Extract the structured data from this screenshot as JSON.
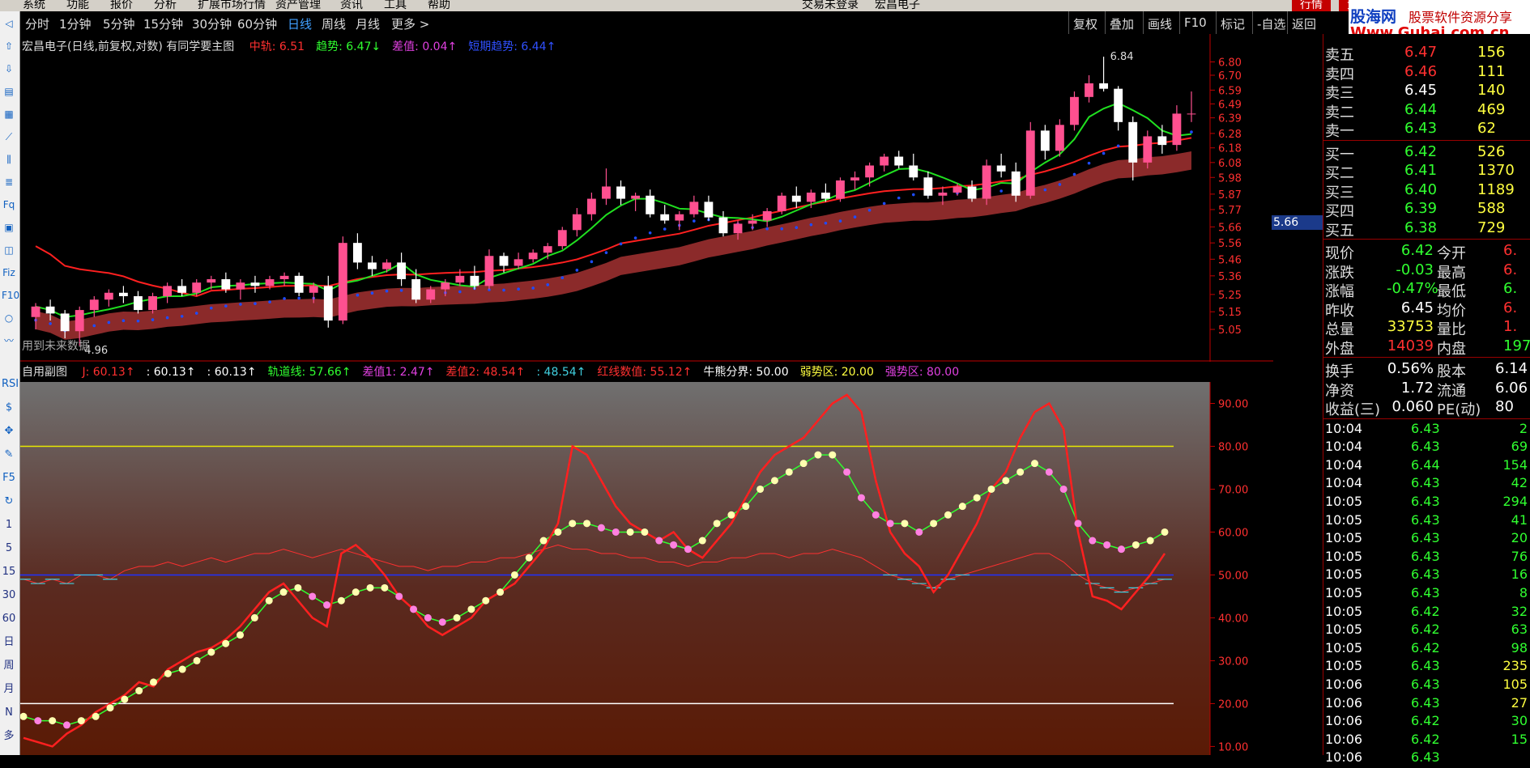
{
  "menubar": {
    "items": [
      "系统",
      "功能",
      "报价",
      "分析",
      "扩展市场行情",
      "资产管理",
      "资讯",
      "工具",
      "帮助"
    ],
    "center_left": "交易未登录",
    "center_right": "宏昌电子",
    "right_buttons": [
      "行情",
      "资"
    ]
  },
  "banner": {
    "site": "股海网",
    "slogan": "股票软件资源分享",
    "url": "Www.Guhai.com.cn"
  },
  "left_toolbar": {
    "icons": [
      "back-arrow-icon",
      "up-arrow-icon",
      "down-arrow-icon",
      "report-icon",
      "grid-icon",
      "line-chart-icon",
      "candle-icon",
      "list-icon",
      "fq-icon",
      "news-icon",
      "calendar-icon",
      "fiz-icon",
      "f10-icon",
      "circle-icon",
      "wave-icon"
    ],
    "labels": [
      "RSI",
      "$",
      "✥",
      "✎",
      "F5",
      "↻",
      "1",
      "5",
      "15",
      "30",
      "60",
      "日",
      "周",
      "月",
      "N",
      "多"
    ]
  },
  "period_bar": {
    "periods": [
      "分时",
      "1分钟",
      "5分钟",
      "15分钟",
      "30分钟",
      "60分钟",
      "日线",
      "周线",
      "月线",
      "更多 >"
    ],
    "active": "日线",
    "right_buttons": [
      "复权",
      "叠加",
      "画线",
      "F10",
      "标记",
      "-自选",
      "返回"
    ]
  },
  "main_chart": {
    "title": "宏昌电子(日线,前复权,对数) 有同学要主图",
    "legend": [
      {
        "label": "中轨: 6.51",
        "color": "#ff3030"
      },
      {
        "label": "趋势: 6.47↓",
        "color": "#30ff30"
      },
      {
        "label": "差值: 0.04↑",
        "color": "#e040e0"
      },
      {
        "label": "短期趋势: 6.44↑",
        "color": "#3050ff"
      }
    ],
    "price_axis": [
      "6.80",
      "6.70",
      "6.59",
      "6.49",
      "6.39",
      "6.28",
      "6.18",
      "6.08",
      "5.98",
      "5.87",
      "5.77",
      "5.66",
      "5.56",
      "5.46",
      "5.36",
      "5.25",
      "5.15",
      "5.05"
    ],
    "current_price_label": "5.66",
    "high_label": "6.84",
    "low_label": "4.96",
    "no_data_text": "用到未来数据"
  },
  "sub_chart": {
    "title": "自用副图",
    "legend": [
      {
        "label": "J: 60.13↑",
        "color": "#ff3030"
      },
      {
        "label": ": 60.13↑",
        "color": "#ffffff"
      },
      {
        "label": ": 60.13↑",
        "color": "#ffffff"
      },
      {
        "label": "轨道线: 57.66↑",
        "color": "#30ff30"
      },
      {
        "label": "差值1: 2.47↑",
        "color": "#e040e0"
      },
      {
        "label": "差值2: 48.54↑",
        "color": "#ff3030"
      },
      {
        "label": ": 48.54↑",
        "color": "#40d0e0"
      },
      {
        "label": "红线数值: 55.12↑",
        "color": "#ff3030"
      },
      {
        "label": "牛熊分界: 50.00",
        "color": "#ffffff"
      },
      {
        "label": "弱势区: 20.00",
        "color": "#ffff40"
      },
      {
        "label": "强势区: 80.00",
        "color": "#e040e0"
      }
    ],
    "axis": [
      "90.00",
      "80.00",
      "70.00",
      "60.00",
      "50.00",
      "40.00",
      "30.00",
      "20.00",
      "10.00"
    ]
  },
  "quote": {
    "sell": [
      {
        "label": "卖五",
        "price": "6.47",
        "vol": "156"
      },
      {
        "label": "卖四",
        "price": "6.46",
        "vol": "111"
      },
      {
        "label": "卖三",
        "price": "6.45",
        "vol": "140"
      },
      {
        "label": "卖二",
        "price": "6.44",
        "vol": "469"
      },
      {
        "label": "卖一",
        "price": "6.43",
        "vol": "62"
      }
    ],
    "buy": [
      {
        "label": "买一",
        "price": "6.42",
        "vol": "526"
      },
      {
        "label": "买二",
        "price": "6.41",
        "vol": "1370"
      },
      {
        "label": "买三",
        "price": "6.40",
        "vol": "1189"
      },
      {
        "label": "买四",
        "price": "6.39",
        "vol": "588"
      },
      {
        "label": "买五",
        "price": "6.38",
        "vol": "729"
      }
    ],
    "stats": [
      {
        "l1": "现价",
        "v1": "6.42",
        "c1": "#30ff30",
        "l2": "今开",
        "v2": "6.",
        "c2": "#ff3030"
      },
      {
        "l1": "涨跌",
        "v1": "-0.03",
        "c1": "#30ff30",
        "l2": "最高",
        "v2": "6.",
        "c2": "#ff3030"
      },
      {
        "l1": "涨幅",
        "v1": "-0.47%",
        "c1": "#30ff30",
        "l2": "最低",
        "v2": "6.",
        "c2": "#30ff30"
      },
      {
        "l1": "昨收",
        "v1": "6.45",
        "c1": "#ffffff",
        "l2": "均价",
        "v2": "6.",
        "c2": "#ff3030"
      },
      {
        "l1": "总量",
        "v1": "33753",
        "c1": "#ffff40",
        "l2": "量比",
        "v2": "1.",
        "c2": "#ff3030"
      },
      {
        "l1": "外盘",
        "v1": "14039",
        "c1": "#ff3030",
        "l2": "内盘",
        "v2": "197",
        "c2": "#30ff30"
      }
    ],
    "fin": [
      {
        "l1": "换手",
        "v1": "0.56%",
        "l2": "股本",
        "v2": "6.14"
      },
      {
        "l1": "净资",
        "v1": "1.72",
        "l2": "流通",
        "v2": "6.06"
      },
      {
        "l1": "收益(三)",
        "v1": "0.060",
        "l2": "PE(动)",
        "v2": "80"
      }
    ],
    "ticks": [
      {
        "t": "10:04",
        "p": "6.43",
        "v": "2",
        "c": "#30ff30"
      },
      {
        "t": "10:04",
        "p": "6.43",
        "v": "69",
        "c": "#30ff30"
      },
      {
        "t": "10:04",
        "p": "6.44",
        "v": "154",
        "c": "#30ff30"
      },
      {
        "t": "10:04",
        "p": "6.43",
        "v": "42",
        "c": "#30ff30"
      },
      {
        "t": "10:05",
        "p": "6.43",
        "v": "294",
        "c": "#30ff30"
      },
      {
        "t": "10:05",
        "p": "6.43",
        "v": "41",
        "c": "#30ff30"
      },
      {
        "t": "10:05",
        "p": "6.43",
        "v": "20",
        "c": "#30ff30"
      },
      {
        "t": "10:05",
        "p": "6.43",
        "v": "76",
        "c": "#30ff30"
      },
      {
        "t": "10:05",
        "p": "6.43",
        "v": "16",
        "c": "#30ff30"
      },
      {
        "t": "10:05",
        "p": "6.43",
        "v": "8",
        "c": "#30ff30"
      },
      {
        "t": "10:05",
        "p": "6.42",
        "v": "32",
        "c": "#30ff30"
      },
      {
        "t": "10:05",
        "p": "6.42",
        "v": "63",
        "c": "#30ff30"
      },
      {
        "t": "10:05",
        "p": "6.42",
        "v": "98",
        "c": "#30ff30"
      },
      {
        "t": "10:05",
        "p": "6.43",
        "v": "235",
        "c": "#ffff40"
      },
      {
        "t": "10:06",
        "p": "6.43",
        "v": "105",
        "c": "#ffff40"
      },
      {
        "t": "10:06",
        "p": "6.43",
        "v": "27",
        "c": "#ffff40"
      },
      {
        "t": "10:06",
        "p": "6.42",
        "v": "30",
        "c": "#30ff30"
      },
      {
        "t": "10:06",
        "p": "6.42",
        "v": "15",
        "c": "#30ff30"
      },
      {
        "t": "10:06",
        "p": "6.43",
        "v": "",
        "c": "#30ff30"
      }
    ]
  },
  "colors": {
    "up": "#ff5090",
    "down": "#ffffff",
    "frame": "#c00000",
    "ma_red": "#ff2020",
    "ma_green": "#20e020",
    "band": "#8b2a2a",
    "dots": "#1e4cff"
  },
  "chart_data": [
    {
      "type": "candlestick",
      "title": "宏昌电子(日线,前复权,对数) 有同学要主图",
      "ylim": [
        4.96,
        6.84
      ],
      "ohlc": [
        [
          5.12,
          5.2,
          5.05,
          5.18
        ],
        [
          5.18,
          5.22,
          5.1,
          5.14
        ],
        [
          5.14,
          5.16,
          5.0,
          5.04
        ],
        [
          5.04,
          5.18,
          4.96,
          5.16
        ],
        [
          5.16,
          5.24,
          5.12,
          5.22
        ],
        [
          5.22,
          5.28,
          5.18,
          5.26
        ],
        [
          5.26,
          5.3,
          5.2,
          5.24
        ],
        [
          5.24,
          5.27,
          5.14,
          5.16
        ],
        [
          5.16,
          5.26,
          5.14,
          5.24
        ],
        [
          5.24,
          5.32,
          5.2,
          5.3
        ],
        [
          5.3,
          5.34,
          5.24,
          5.26
        ],
        [
          5.26,
          5.34,
          5.24,
          5.32
        ],
        [
          5.32,
          5.36,
          5.28,
          5.34
        ],
        [
          5.34,
          5.38,
          5.26,
          5.28
        ],
        [
          5.28,
          5.34,
          5.22,
          5.32
        ],
        [
          5.32,
          5.36,
          5.26,
          5.3
        ],
        [
          5.3,
          5.36,
          5.28,
          5.34
        ],
        [
          5.34,
          5.38,
          5.3,
          5.36
        ],
        [
          5.36,
          5.38,
          5.24,
          5.26
        ],
        [
          5.26,
          5.32,
          5.2,
          5.3
        ],
        [
          5.3,
          5.36,
          5.06,
          5.1
        ],
        [
          5.1,
          5.6,
          5.08,
          5.56
        ],
        [
          5.56,
          5.62,
          5.4,
          5.44
        ],
        [
          5.44,
          5.48,
          5.36,
          5.4
        ],
        [
          5.4,
          5.46,
          5.38,
          5.44
        ],
        [
          5.44,
          5.5,
          5.3,
          5.34
        ],
        [
          5.34,
          5.4,
          5.2,
          5.22
        ],
        [
          5.22,
          5.3,
          5.2,
          5.28
        ],
        [
          5.28,
          5.34,
          5.24,
          5.32
        ],
        [
          5.32,
          5.4,
          5.3,
          5.36
        ],
        [
          5.36,
          5.42,
          5.28,
          5.3
        ],
        [
          5.3,
          5.52,
          5.28,
          5.48
        ],
        [
          5.48,
          5.5,
          5.38,
          5.42
        ],
        [
          5.42,
          5.5,
          5.4,
          5.46
        ],
        [
          5.46,
          5.52,
          5.44,
          5.5
        ],
        [
          5.5,
          5.56,
          5.46,
          5.54
        ],
        [
          5.54,
          5.66,
          5.52,
          5.64
        ],
        [
          5.64,
          5.78,
          5.6,
          5.74
        ],
        [
          5.74,
          5.88,
          5.7,
          5.84
        ],
        [
          5.84,
          6.04,
          5.8,
          5.92
        ],
        [
          5.92,
          5.96,
          5.8,
          5.84
        ],
        [
          5.84,
          5.88,
          5.76,
          5.86
        ],
        [
          5.86,
          5.9,
          5.72,
          5.74
        ],
        [
          5.74,
          5.8,
          5.68,
          5.7
        ],
        [
          5.7,
          5.76,
          5.64,
          5.74
        ],
        [
          5.74,
          5.86,
          5.72,
          5.82
        ],
        [
          5.82,
          5.86,
          5.7,
          5.72
        ],
        [
          5.72,
          5.76,
          5.6,
          5.62
        ],
        [
          5.62,
          5.7,
          5.58,
          5.68
        ],
        [
          5.68,
          5.74,
          5.64,
          5.7
        ],
        [
          5.7,
          5.78,
          5.66,
          5.76
        ],
        [
          5.76,
          5.88,
          5.74,
          5.86
        ],
        [
          5.86,
          5.92,
          5.78,
          5.82
        ],
        [
          5.82,
          5.9,
          5.78,
          5.88
        ],
        [
          5.88,
          5.94,
          5.82,
          5.84
        ],
        [
          5.84,
          5.98,
          5.82,
          5.96
        ],
        [
          5.96,
          6.02,
          5.9,
          5.98
        ],
        [
          5.98,
          6.08,
          5.92,
          6.06
        ],
        [
          6.06,
          6.14,
          6.02,
          6.12
        ],
        [
          6.12,
          6.16,
          6.04,
          6.06
        ],
        [
          6.06,
          6.14,
          5.96,
          5.98
        ],
        [
          5.98,
          6.02,
          5.84,
          5.86
        ],
        [
          5.86,
          5.92,
          5.8,
          5.88
        ],
        [
          5.88,
          5.94,
          5.86,
          5.92
        ],
        [
          5.92,
          5.96,
          5.82,
          5.84
        ],
        [
          5.84,
          6.1,
          5.8,
          6.06
        ],
        [
          6.06,
          6.14,
          5.98,
          6.02
        ],
        [
          6.02,
          6.08,
          5.82,
          5.86
        ],
        [
          5.86,
          6.36,
          5.84,
          6.3
        ],
        [
          6.3,
          6.34,
          6.1,
          6.16
        ],
        [
          6.16,
          6.38,
          6.12,
          6.34
        ],
        [
          6.34,
          6.58,
          6.3,
          6.54
        ],
        [
          6.54,
          6.7,
          6.5,
          6.64
        ],
        [
          6.64,
          6.84,
          6.58,
          6.6
        ],
        [
          6.6,
          6.62,
          6.3,
          6.36
        ],
        [
          6.36,
          6.4,
          5.96,
          6.08
        ],
        [
          6.08,
          6.3,
          6.04,
          6.26
        ],
        [
          6.26,
          6.34,
          6.14,
          6.2
        ],
        [
          6.2,
          6.48,
          6.16,
          6.42
        ],
        [
          6.42,
          6.58,
          6.36,
          6.42
        ]
      ]
    },
    {
      "type": "line",
      "title": "自用副图",
      "ylim": [
        8,
        95
      ],
      "series": [
        {
          "name": "J",
          "values": [
            12,
            11,
            10,
            13,
            15,
            18,
            20,
            22,
            25,
            24,
            28,
            30,
            32,
            33,
            35,
            38,
            42,
            46,
            48,
            44,
            40,
            38,
            55,
            57,
            54,
            50,
            45,
            42,
            38,
            36,
            38,
            40,
            44,
            46,
            48,
            52,
            56,
            62,
            80,
            78,
            72,
            66,
            62,
            60,
            58,
            60,
            56,
            54,
            58,
            62,
            68,
            74,
            78,
            80,
            82,
            86,
            90,
            92,
            88,
            72,
            60,
            55,
            52,
            46,
            50,
            56,
            62,
            70,
            74,
            82,
            88,
            90,
            84,
            60,
            45,
            44,
            42,
            46,
            50,
            55
          ]
        },
        {
          "name": "轨道线",
          "values": [
            17,
            16,
            16,
            15,
            16,
            17,
            19,
            21,
            23,
            25,
            27,
            28,
            30,
            32,
            34,
            36,
            40,
            44,
            46,
            47,
            45,
            43,
            44,
            46,
            47,
            47,
            45,
            42,
            40,
            39,
            40,
            42,
            44,
            46,
            50,
            54,
            58,
            60,
            62,
            62,
            61,
            60,
            60,
            60,
            58,
            57,
            56,
            58,
            62,
            64,
            66,
            70,
            72,
            74,
            76,
            78,
            78,
            74,
            68,
            64,
            62,
            62,
            60,
            62,
            64,
            66,
            68,
            70,
            72,
            74,
            76,
            74,
            70,
            62,
            58,
            57,
            56,
            57,
            58,
            60
          ]
        },
        {
          "name": "差值2",
          "values": [
            49,
            48,
            49,
            48,
            50,
            50,
            49,
            51,
            52,
            52,
            53,
            52,
            53,
            54,
            53,
            54,
            55,
            55,
            56,
            55,
            54,
            55,
            56,
            55,
            54,
            53,
            52,
            52,
            51,
            52,
            52,
            53,
            53,
            54,
            54,
            55,
            56,
            57,
            56,
            56,
            55,
            55,
            54,
            54,
            53,
            53,
            52,
            53,
            53,
            54,
            54,
            55,
            55,
            54,
            55,
            55,
            56,
            55,
            54,
            52,
            50,
            49,
            48,
            47,
            49,
            50,
            51,
            52,
            53,
            54,
            55,
            55,
            53,
            50,
            48,
            47,
            46,
            47,
            48,
            49
          ]
        }
      ],
      "annotations": [
        "牛熊分界: 50.00",
        "弱势区: 20.00",
        "强势区: 80.00"
      ]
    }
  ]
}
